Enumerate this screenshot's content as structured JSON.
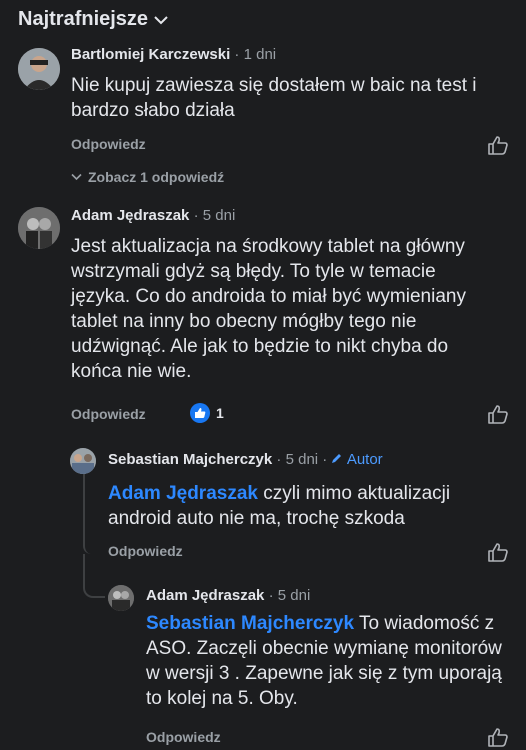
{
  "sort": {
    "label": "Najtrafniejsze"
  },
  "comments": [
    {
      "name": "Bartlomiej Karczewski",
      "time": "1 dni",
      "text": "Nie kupuj zawiesza się dostałem w baic na test i bardzo słabo działa",
      "reply_label": "Odpowiedz",
      "view_replies": "Zobacz 1 odpowiedź"
    },
    {
      "name": "Adam Jędraszak",
      "time": "5 dni",
      "text": "Jest aktualizacja na środkowy tablet na główny wstrzymali gdyż są błędy. To tyle w temacie języka. Co do androida to miał być wymieniany tablet na inny bo obecny mógłby tego nie udźwignąć. Ale jak to będzie to nikt chyba do końca nie wie.",
      "reply_label": "Odpowiedz",
      "reaction_count": "1"
    },
    {
      "name": "Sebastian Majcherczyk",
      "time": "5 dni",
      "author_badge": "Autor",
      "mention": "Adam Jędraszak",
      "text": "czyli mimo aktualizacji android auto nie ma, trochę szkoda",
      "reply_label": "Odpowiedz"
    },
    {
      "name": "Adam Jędraszak",
      "time": "5 dni",
      "mention": "Sebastian Majcherczyk",
      "text": "To wiadomość z ASO. Zaczęli obecnie wymianę monitorów w wersji 3 . Zapewne jak się z tym uporają to kolej na 5. Oby.",
      "reply_label": "Odpowiedz"
    }
  ],
  "colors": {
    "background": "#1c1d1f",
    "mention": "#2d88ff",
    "muted": "#9aa0a6",
    "reaction": "#1877f2"
  },
  "icons": [
    "chevron-down-icon",
    "thumbs-up-icon",
    "like-reaction-icon",
    "pencil-icon"
  ]
}
